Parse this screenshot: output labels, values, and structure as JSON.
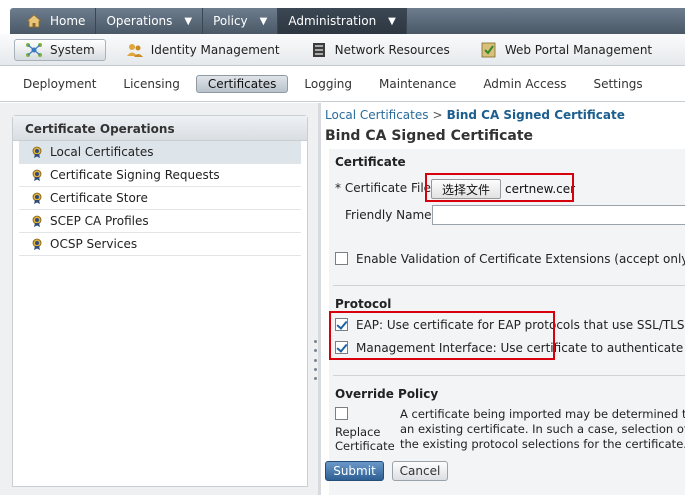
{
  "top_nav": {
    "items": [
      {
        "label": "Home",
        "icon": "home-icon"
      },
      {
        "label": "Operations",
        "caret": "▼"
      },
      {
        "label": "Policy",
        "caret": "▼"
      },
      {
        "label": "Administration",
        "caret": "▼",
        "active": true
      }
    ]
  },
  "sub_nav": {
    "items": [
      {
        "label": "System",
        "icon": "system-icon",
        "active": true
      },
      {
        "label": "Identity Management",
        "icon": "identity-icon"
      },
      {
        "label": "Network Resources",
        "icon": "network-icon"
      },
      {
        "label": "Web Portal Management",
        "icon": "portal-icon"
      }
    ]
  },
  "tabs": [
    "Deployment",
    "Licensing",
    "Certificates",
    "Logging",
    "Maintenance",
    "Admin Access",
    "Settings"
  ],
  "active_tab": "Certificates",
  "left_panel": {
    "title": "Certificate Operations",
    "items": [
      "Local Certificates",
      "Certificate Signing Requests",
      "Certificate Store",
      "SCEP CA Profiles",
      "OCSP Services"
    ],
    "selected": "Local Certificates"
  },
  "breadcrumb": {
    "parent": "Local Certificates",
    "separator": ">",
    "current": "Bind CA Signed Certificate"
  },
  "page_title": "Bind CA Signed Certificate",
  "certificate_section": {
    "title": "Certificate",
    "file_label": "* Certificate File",
    "file_button": "选择文件",
    "file_name": "certnew.cer",
    "friendly_name_label": "Friendly Name",
    "friendly_name_value": "",
    "validation_label": "Enable Validation of Certificate Extensions (accept only valid",
    "validation_checked": false
  },
  "protocol_section": {
    "title": "Protocol",
    "eap_label": "EAP: Use certificate for EAP protocols that use SSL/TLS tun",
    "eap_checked": true,
    "mgmt_label": "Management Interface: Use certificate to authenticate the",
    "mgmt_checked": true
  },
  "override_section": {
    "title": "Override Policy",
    "replace_label_1": "Replace",
    "replace_label_2": "Certificate",
    "replace_checked": false,
    "note_line_1": "A certificate being imported may be determined to",
    "note_line_2": "an existing certificate. In such a case, selection of th",
    "note_line_3": "the existing protocol selections for the certificate."
  },
  "buttons": {
    "submit": "Submit",
    "cancel": "Cancel"
  },
  "colors": {
    "highlight": "#d9000d",
    "link": "#2a6c9c",
    "nav_dark": "#4a5866"
  }
}
